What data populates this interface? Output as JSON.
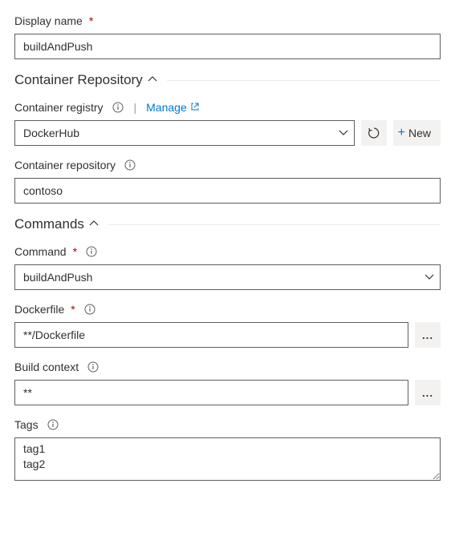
{
  "displayName": {
    "label": "Display name",
    "value": "buildAndPush"
  },
  "sections": {
    "containerRepository": {
      "title": "Container Repository"
    },
    "commands": {
      "title": "Commands"
    }
  },
  "containerRegistry": {
    "label": "Container registry",
    "manageLink": "Manage",
    "value": "DockerHub",
    "newButton": "New"
  },
  "containerRepo": {
    "label": "Container repository",
    "value": "contoso"
  },
  "command": {
    "label": "Command",
    "value": "buildAndPush"
  },
  "dockerfile": {
    "label": "Dockerfile",
    "value": "**/Dockerfile"
  },
  "buildContext": {
    "label": "Build context",
    "value": "**"
  },
  "tags": {
    "label": "Tags",
    "value": "tag1\ntag2"
  },
  "dots": "..."
}
